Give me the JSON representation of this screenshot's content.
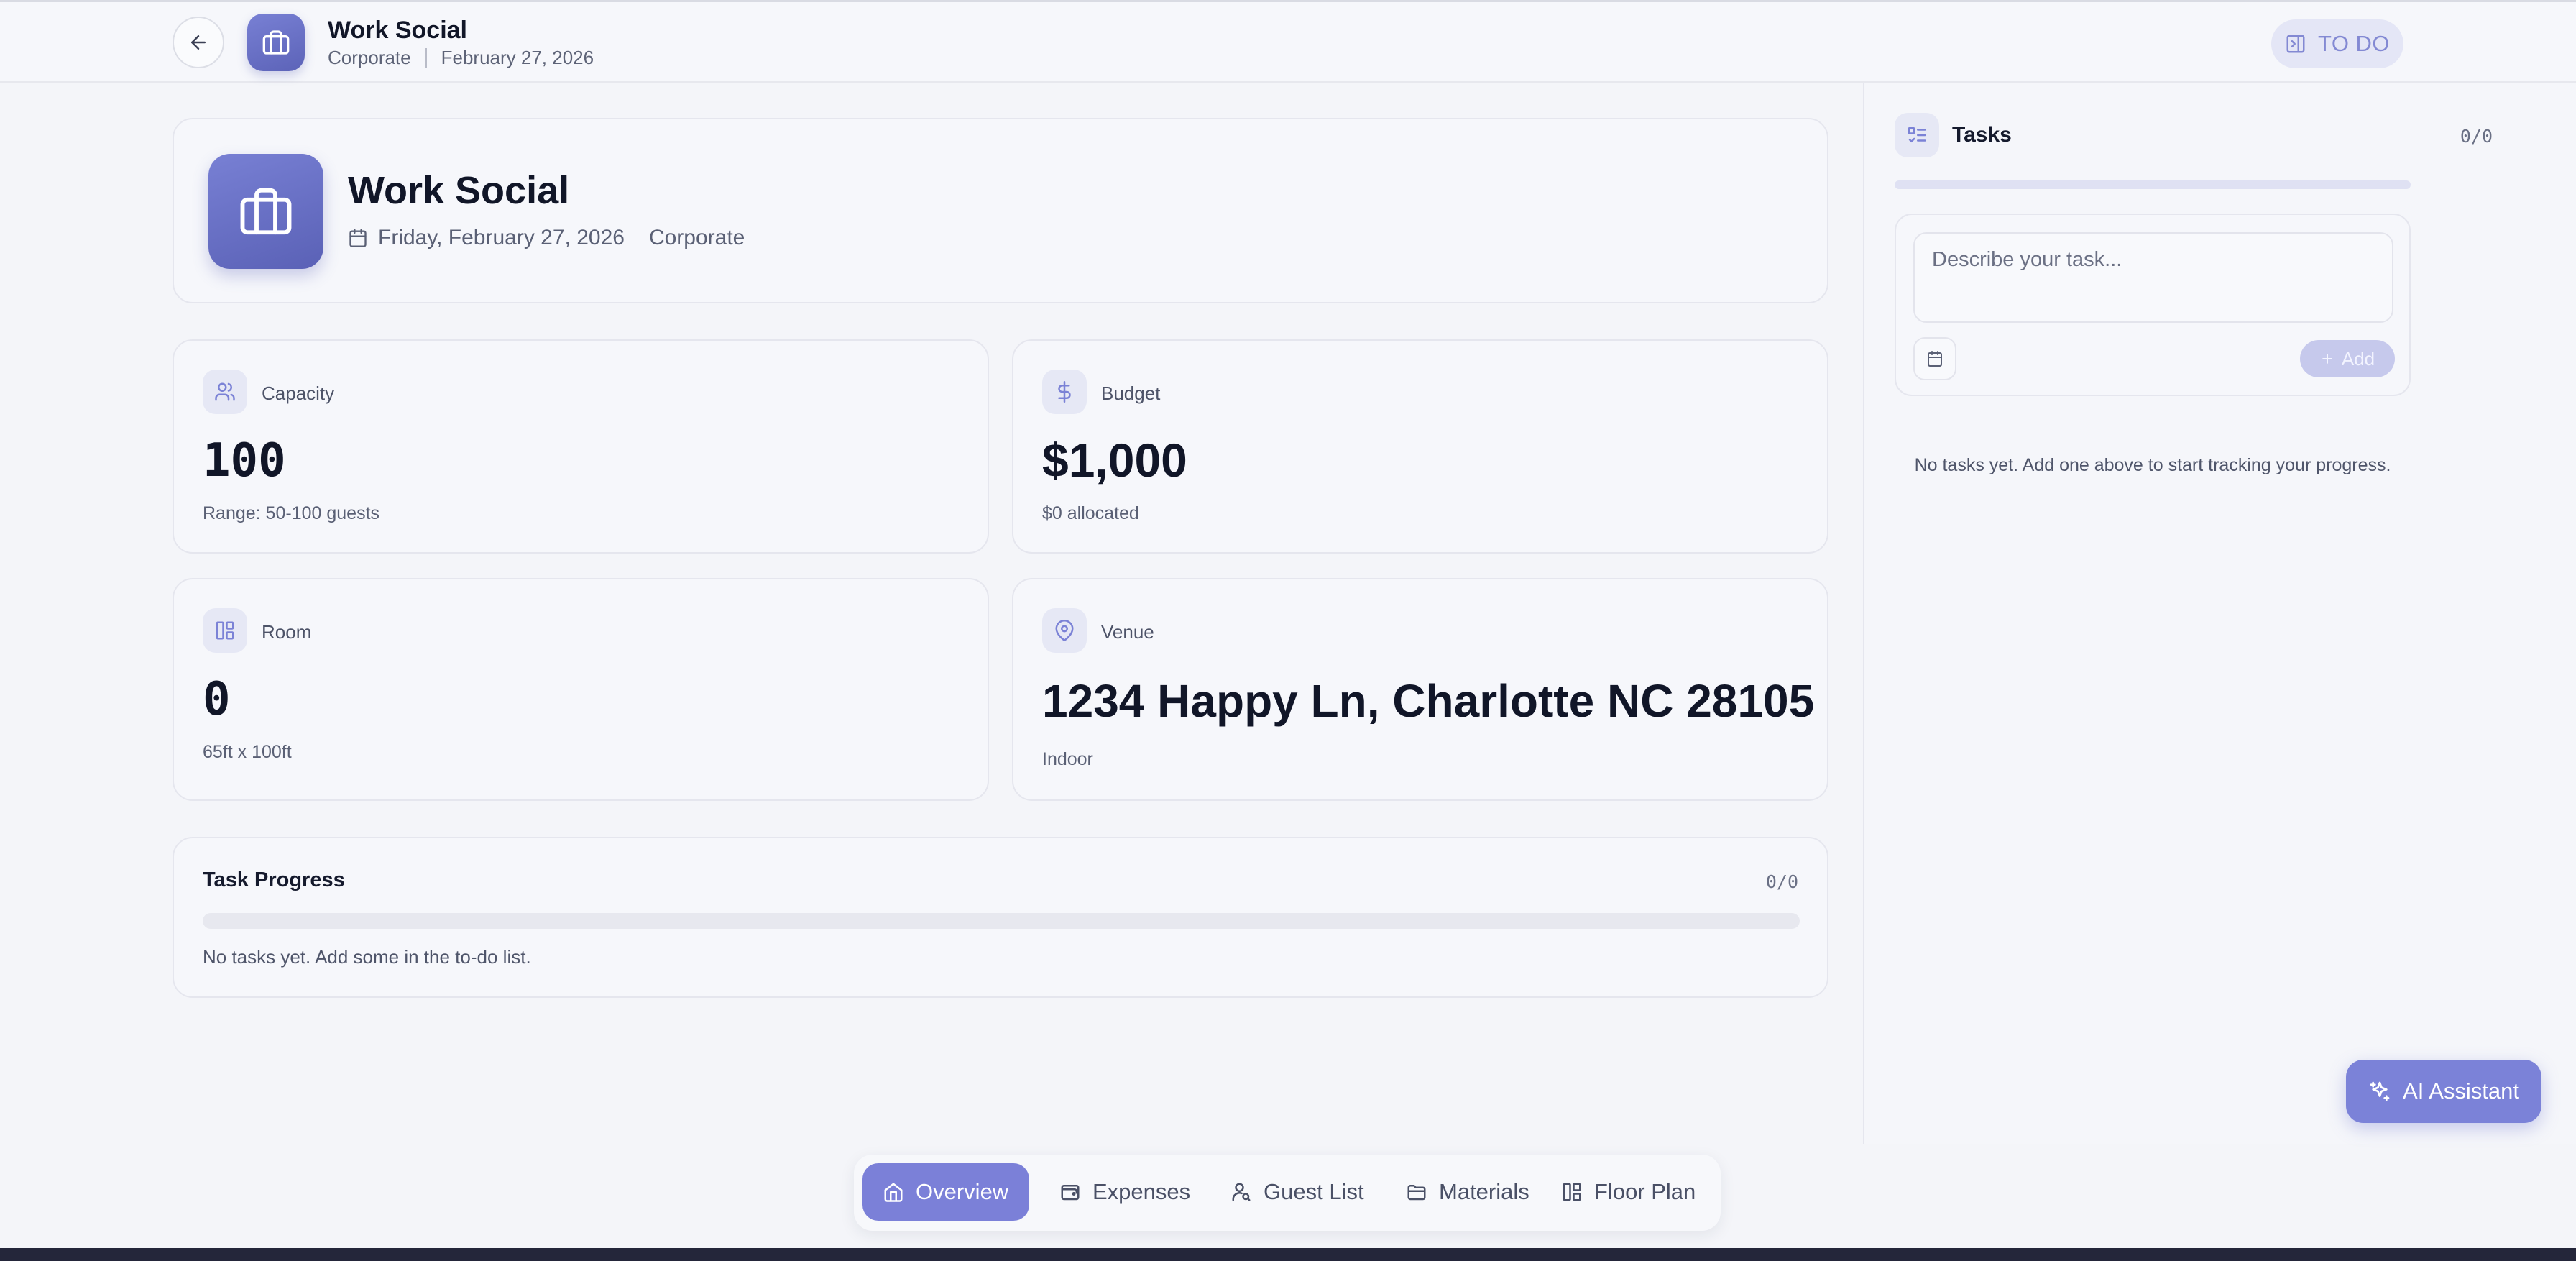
{
  "header": {
    "title": "Work Social",
    "category": "Corporate",
    "date": "February 27, 2026",
    "todo_label": "TO DO",
    "icons": {
      "back": "arrow-left-icon",
      "logo": "briefcase-icon",
      "todo": "panel-toggle-icon"
    }
  },
  "event": {
    "title": "Work Social",
    "full_date": "Friday, February 27, 2026",
    "category": "Corporate"
  },
  "stats": {
    "capacity": {
      "label": "Capacity",
      "value": "100",
      "sub": "Range: 50-100 guests",
      "icon": "users-icon"
    },
    "budget": {
      "label": "Budget",
      "value": "$1,000",
      "sub": "$0 allocated",
      "icon": "dollar-icon"
    },
    "room": {
      "label": "Room",
      "value": "0",
      "sub": "65ft x 100ft",
      "icon": "layout-icon"
    },
    "venue": {
      "label": "Venue",
      "value": "1234 Happy Ln, Charlotte NC 28105",
      "sub": "Indoor",
      "icon": "map-pin-icon"
    }
  },
  "task_progress": {
    "title": "Task Progress",
    "count": "0/0",
    "progress_fraction": 0,
    "empty_text": "No tasks yet. Add some in the to-do list."
  },
  "sidebar": {
    "title": "Tasks",
    "count": "0/0",
    "progress_fraction": 0,
    "input_placeholder": "Describe your task...",
    "add_label": "Add",
    "empty_text": "No tasks yet. Add one above to start tracking your progress."
  },
  "nav": {
    "items": [
      {
        "label": "Overview",
        "icon": "home-icon",
        "active": true
      },
      {
        "label": "Expenses",
        "icon": "wallet-icon",
        "active": false
      },
      {
        "label": "Guest List",
        "icon": "user-search-icon",
        "active": false
      },
      {
        "label": "Materials",
        "icon": "folder-icon",
        "active": false
      },
      {
        "label": "Floor Plan",
        "icon": "layout-icon",
        "active": false
      }
    ]
  },
  "ai_assistant": {
    "label": "AI Assistant",
    "icon": "sparkles-icon"
  },
  "colors": {
    "accent": "#7b82d8",
    "accent_dark": "#5c63b8",
    "text": "#151a2d",
    "muted": "#5a6075"
  }
}
